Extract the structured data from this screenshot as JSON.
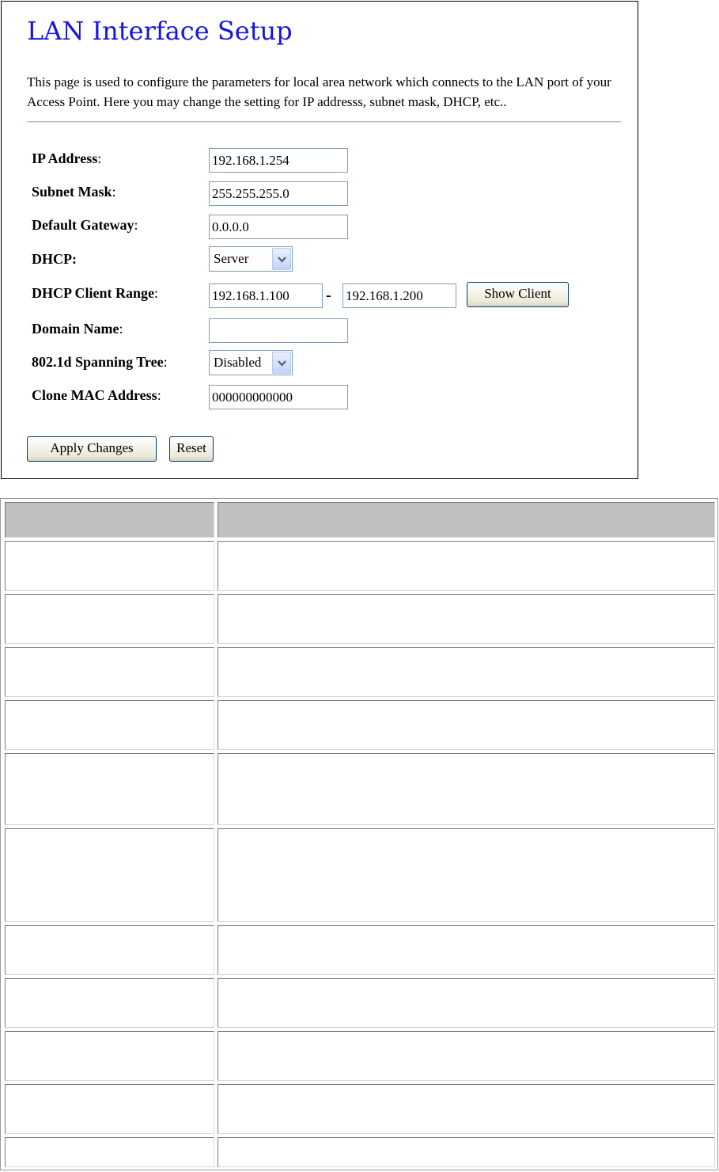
{
  "page": {
    "title": "LAN Interface Setup",
    "intro": "This page is used to configure the parameters for local area network which connects to the LAN port of your Access Point. Here you may change the setting for IP addresss, subnet mask, DHCP, etc.."
  },
  "form": {
    "ip_address": {
      "label": "IP Address",
      "colon": ":",
      "value": "192.168.1.254"
    },
    "subnet_mask": {
      "label": "Subnet Mask",
      "colon": ":",
      "value": "255.255.255.0"
    },
    "default_gateway": {
      "label": "Default Gateway",
      "colon": ":",
      "value": "0.0.0.0"
    },
    "dhcp": {
      "label": "DHCP:",
      "selected": "Server"
    },
    "dhcp_client_range": {
      "label": "DHCP Client Range",
      "colon": ":",
      "start": "192.168.1.100",
      "separator": "-",
      "end": "192.168.1.200",
      "show_client_label": "Show Client"
    },
    "domain_name": {
      "label": "Domain Name",
      "colon": ":",
      "value": ""
    },
    "spanning_tree": {
      "label": "802.1d Spanning Tree",
      "colon": ":",
      "selected": "Disabled"
    },
    "clone_mac": {
      "label": "Clone MAC Address",
      "colon": ":",
      "value": "000000000000"
    }
  },
  "buttons": {
    "apply": "Apply Changes",
    "reset": "Reset"
  },
  "table": {
    "header": [
      "",
      ""
    ],
    "row_count": 11
  },
  "icons": {
    "dropdown": "chevron-down-icon"
  },
  "colors": {
    "title": "#1515e0",
    "table_header": "#c0c0c0",
    "field_border": "#7f9db9"
  }
}
